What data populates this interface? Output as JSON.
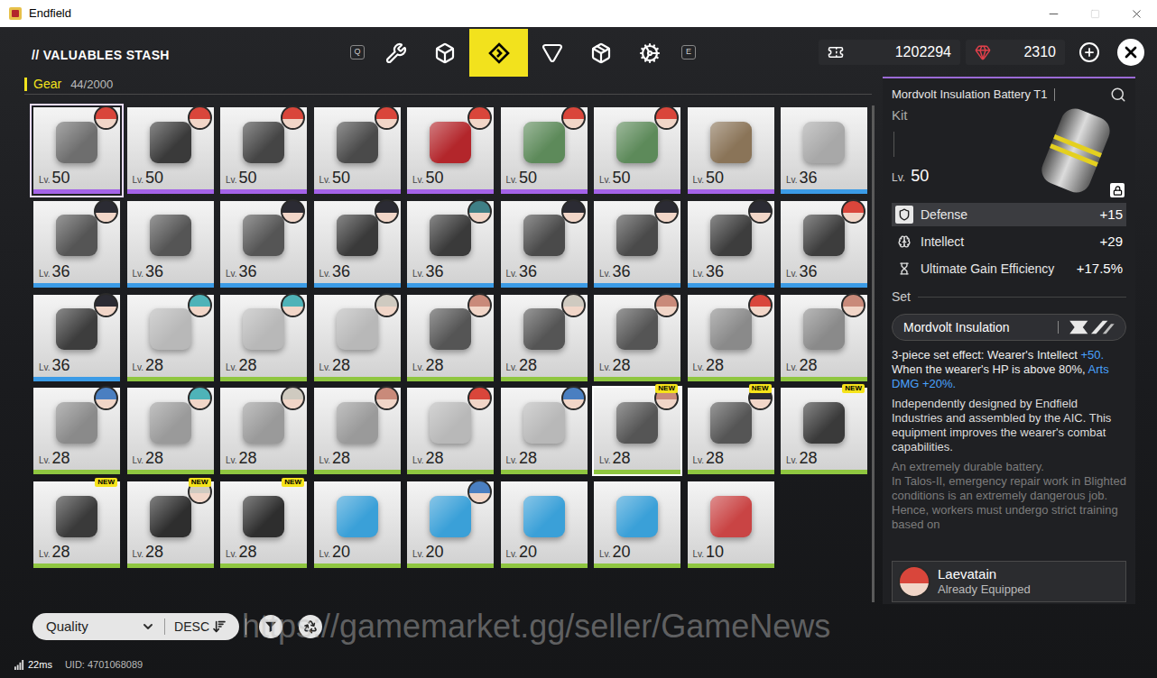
{
  "window": {
    "title": "Endfield",
    "controls": [
      {
        "kind": "minimize",
        "disabled": false
      },
      {
        "kind": "maximize",
        "disabled": true
      },
      {
        "kind": "close",
        "disabled": false
      }
    ]
  },
  "header": {
    "title": "// VALUABLES STASH",
    "prev_key": "Q",
    "next_key": "E",
    "tabs": [
      {
        "kind": "tool",
        "selected": false
      },
      {
        "kind": "cube",
        "selected": false
      },
      {
        "kind": "kit",
        "selected": true
      },
      {
        "kind": "triangle",
        "selected": false
      },
      {
        "kind": "crate",
        "selected": false
      },
      {
        "kind": "cog",
        "selected": false
      }
    ],
    "currencies": [
      {
        "kind": "ticket",
        "value": "1202294",
        "color": "#ffffff"
      },
      {
        "kind": "gem",
        "value": "2310",
        "color": "#e0404a"
      }
    ]
  },
  "category": {
    "label": "Gear",
    "count": "44/2000"
  },
  "grid": {
    "level_label": "Lv.",
    "new_label": "NEW",
    "items": [
      {
        "level": "50",
        "rarity_color": "#a463e8",
        "image_color": "#6e6e6e",
        "avatar_color": "#d9463b",
        "new": false,
        "selected": true,
        "hovered": false
      },
      {
        "level": "50",
        "rarity_color": "#a463e8",
        "image_color": "#3a3a3a",
        "avatar_color": "#d9463b",
        "new": false,
        "selected": false,
        "hovered": false
      },
      {
        "level": "50",
        "rarity_color": "#a463e8",
        "image_color": "#454545",
        "avatar_color": "#d9463b",
        "new": false,
        "selected": false,
        "hovered": false
      },
      {
        "level": "50",
        "rarity_color": "#a463e8",
        "image_color": "#4a4a4a",
        "avatar_color": "#d9463b",
        "new": false,
        "selected": false,
        "hovered": false
      },
      {
        "level": "50",
        "rarity_color": "#a463e8",
        "image_color": "#b3262b",
        "avatar_color": "#d9463b",
        "new": false,
        "selected": false,
        "hovered": false
      },
      {
        "level": "50",
        "rarity_color": "#a463e8",
        "image_color": "#5d8a5a",
        "avatar_color": "#d9463b",
        "new": false,
        "selected": false,
        "hovered": false
      },
      {
        "level": "50",
        "rarity_color": "#a463e8",
        "image_color": "#5d8a5a",
        "avatar_color": "#d9463b",
        "new": false,
        "selected": false,
        "hovered": false
      },
      {
        "level": "50",
        "rarity_color": "#a463e8",
        "image_color": "#8a7458",
        "avatar_color": null,
        "new": false,
        "selected": false,
        "hovered": false
      },
      {
        "level": "36",
        "rarity_color": "#3b9be6",
        "image_color": "#a8a8a8",
        "avatar_color": null,
        "new": false,
        "selected": false,
        "hovered": false
      },
      {
        "level": "36",
        "rarity_color": "#3b9be6",
        "image_color": "#555555",
        "avatar_color": "#2b2b33",
        "new": false,
        "selected": false,
        "hovered": false
      },
      {
        "level": "36",
        "rarity_color": "#3b9be6",
        "image_color": "#555555",
        "avatar_color": null,
        "new": false,
        "selected": false,
        "hovered": false
      },
      {
        "level": "36",
        "rarity_color": "#3b9be6",
        "image_color": "#555555",
        "avatar_color": "#2b2b33",
        "new": false,
        "selected": false,
        "hovered": false
      },
      {
        "level": "36",
        "rarity_color": "#3b9be6",
        "image_color": "#3a3a3a",
        "avatar_color": "#2b2b33",
        "new": false,
        "selected": false,
        "hovered": false
      },
      {
        "level": "36",
        "rarity_color": "#3b9be6",
        "image_color": "#3a3a3a",
        "avatar_color": "#3f7f86",
        "new": false,
        "selected": false,
        "hovered": false
      },
      {
        "level": "36",
        "rarity_color": "#3b9be6",
        "image_color": "#4a4a4a",
        "avatar_color": "#2b2b33",
        "new": false,
        "selected": false,
        "hovered": false
      },
      {
        "level": "36",
        "rarity_color": "#3b9be6",
        "image_color": "#4a4a4a",
        "avatar_color": "#2b2b33",
        "new": false,
        "selected": false,
        "hovered": false
      },
      {
        "level": "36",
        "rarity_color": "#3b9be6",
        "image_color": "#3d3d3d",
        "avatar_color": "#2b2b33",
        "new": false,
        "selected": false,
        "hovered": false
      },
      {
        "level": "36",
        "rarity_color": "#3b9be6",
        "image_color": "#3d3d3d",
        "avatar_color": "#d9463b",
        "new": false,
        "selected": false,
        "hovered": false
      },
      {
        "level": "36",
        "rarity_color": "#3b9be6",
        "image_color": "#3d3d3d",
        "avatar_color": "#2b2b33",
        "new": false,
        "selected": false,
        "hovered": false
      },
      {
        "level": "28",
        "rarity_color": "#8fc640",
        "image_color": "#b8b8b8",
        "avatar_color": "#4fb3b8",
        "new": false,
        "selected": false,
        "hovered": false
      },
      {
        "level": "28",
        "rarity_color": "#8fc640",
        "image_color": "#b8b8b8",
        "avatar_color": "#4fb3b8",
        "new": false,
        "selected": false,
        "hovered": false
      },
      {
        "level": "28",
        "rarity_color": "#8fc640",
        "image_color": "#b8b8b8",
        "avatar_color": "#cfcac0",
        "new": false,
        "selected": false,
        "hovered": false
      },
      {
        "level": "28",
        "rarity_color": "#8fc640",
        "image_color": "#555555",
        "avatar_color": "#c98a7a",
        "new": false,
        "selected": false,
        "hovered": false
      },
      {
        "level": "28",
        "rarity_color": "#8fc640",
        "image_color": "#555555",
        "avatar_color": "#cfcac0",
        "new": false,
        "selected": false,
        "hovered": false
      },
      {
        "level": "28",
        "rarity_color": "#8fc640",
        "image_color": "#555555",
        "avatar_color": "#c98a7a",
        "new": false,
        "selected": false,
        "hovered": false
      },
      {
        "level": "28",
        "rarity_color": "#8fc640",
        "image_color": "#8a8a8a",
        "avatar_color": "#d9463b",
        "new": false,
        "selected": false,
        "hovered": false
      },
      {
        "level": "28",
        "rarity_color": "#8fc640",
        "image_color": "#8a8a8a",
        "avatar_color": "#c98a7a",
        "new": false,
        "selected": false,
        "hovered": false
      },
      {
        "level": "28",
        "rarity_color": "#8fc640",
        "image_color": "#8a8a8a",
        "avatar_color": "#4a7fc1",
        "new": false,
        "selected": false,
        "hovered": false
      },
      {
        "level": "28",
        "rarity_color": "#8fc640",
        "image_color": "#9a9a9a",
        "avatar_color": "#4fb3b8",
        "new": false,
        "selected": false,
        "hovered": false
      },
      {
        "level": "28",
        "rarity_color": "#8fc640",
        "image_color": "#9a9a9a",
        "avatar_color": "#cfcac0",
        "new": false,
        "selected": false,
        "hovered": false
      },
      {
        "level": "28",
        "rarity_color": "#8fc640",
        "image_color": "#9a9a9a",
        "avatar_color": "#c98a7a",
        "new": false,
        "selected": false,
        "hovered": false
      },
      {
        "level": "28",
        "rarity_color": "#8fc640",
        "image_color": "#b8b8b8",
        "avatar_color": "#d9463b",
        "new": false,
        "selected": false,
        "hovered": false
      },
      {
        "level": "28",
        "rarity_color": "#8fc640",
        "image_color": "#b8b8b8",
        "avatar_color": "#4a7fc1",
        "new": false,
        "selected": false,
        "hovered": false
      },
      {
        "level": "28",
        "rarity_color": "#8fc640",
        "image_color": "#555555",
        "avatar_color": "#c98a7a",
        "new": true,
        "selected": false,
        "hovered": true
      },
      {
        "level": "28",
        "rarity_color": "#8fc640",
        "image_color": "#555555",
        "avatar_color": "#2b2b33",
        "new": true,
        "selected": false,
        "hovered": false
      },
      {
        "level": "28",
        "rarity_color": "#8fc640",
        "image_color": "#3a3a3a",
        "avatar_color": null,
        "new": true,
        "selected": false,
        "hovered": false
      },
      {
        "level": "28",
        "rarity_color": "#8fc640",
        "image_color": "#3a3a3a",
        "avatar_color": null,
        "new": true,
        "selected": false,
        "hovered": false
      },
      {
        "level": "28",
        "rarity_color": "#8fc640",
        "image_color": "#2e2e2e",
        "avatar_color": "#cfcac0",
        "new": true,
        "selected": false,
        "hovered": false
      },
      {
        "level": "28",
        "rarity_color": "#8fc640",
        "image_color": "#2e2e2e",
        "avatar_color": null,
        "new": true,
        "selected": false,
        "hovered": false
      },
      {
        "level": "20",
        "rarity_color": "#8fc640",
        "image_color": "#3aa0d8",
        "avatar_color": null,
        "new": false,
        "selected": false,
        "hovered": false
      },
      {
        "level": "20",
        "rarity_color": "#8fc640",
        "image_color": "#3aa0d8",
        "avatar_color": "#4a7fc1",
        "new": false,
        "selected": false,
        "hovered": false
      },
      {
        "level": "20",
        "rarity_color": "#8fc640",
        "image_color": "#3aa0d8",
        "avatar_color": null,
        "new": false,
        "selected": false,
        "hovered": false
      },
      {
        "level": "20",
        "rarity_color": "#8fc640",
        "image_color": "#3aa0d8",
        "avatar_color": null,
        "new": false,
        "selected": false,
        "hovered": false
      },
      {
        "level": "10",
        "rarity_color": "#8fc640",
        "image_color": "#c94444",
        "avatar_color": null,
        "new": false,
        "selected": false,
        "hovered": false
      }
    ]
  },
  "sort": {
    "field": "Quality",
    "order": "DESC"
  },
  "detail": {
    "name": "Mordvolt Insulation Battery T1",
    "type": "Kit",
    "level_label": "Lv.",
    "level": "50",
    "stats": [
      {
        "kind": "defense",
        "label": "Defense",
        "value": "+15",
        "highlighted": true
      },
      {
        "kind": "intellect",
        "label": "Intellect",
        "value": "+29",
        "highlighted": false
      },
      {
        "kind": "ultimate",
        "label": "Ultimate Gain Efficiency",
        "value": "+17.5%",
        "highlighted": false
      }
    ],
    "set_label": "Set",
    "set_name": "Mordvolt Insulation",
    "set_effect": [
      [
        {
          "text": "3-piece set effect: Wearer's Intellect ",
          "highlight": false
        },
        {
          "text": "+50.",
          "highlight": true
        }
      ],
      [
        {
          "text": "When the wearer's HP is above 80%, ",
          "highlight": false
        },
        {
          "text": "Arts DMG +20%.",
          "highlight": true
        }
      ]
    ],
    "description": "Independently designed by Endfield Industries and assembled by the AIC. This equipment improves the wearer's combat capabilities.",
    "lore": [
      "An extremely durable battery.",
      "In Talos-II, emergency repair work in Blighted conditions is an extremely dangerous job. Hence, workers must undergo strict training based on"
    ],
    "equipped": {
      "name": "Laevatain",
      "status": "Already Equipped",
      "avatar_color": "#d9463b"
    }
  },
  "watermark": "https://gamemarket.gg/seller/GameNews",
  "status": {
    "ping": "22ms",
    "uid": "UID: 4701068089"
  }
}
